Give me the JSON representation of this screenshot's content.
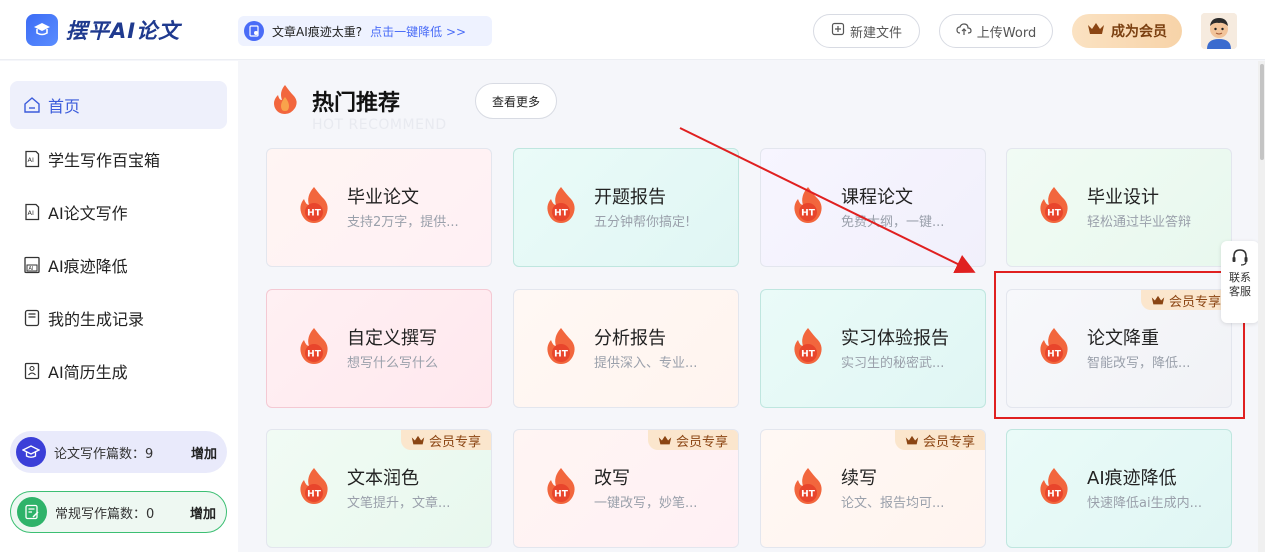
{
  "header": {
    "logo_text": "摆平AI论文",
    "notice_text": "文章AI痕迹太重?",
    "notice_link": "点击一键降低 >>",
    "new_file": "新建文件",
    "upload_word": "上传Word",
    "vip": "成为会员"
  },
  "sidebar": {
    "items": [
      {
        "label": "首页",
        "icon": "home-icon"
      },
      {
        "label": "学生写作百宝箱",
        "icon": "ai-doc-icon"
      },
      {
        "label": "AI论文写作",
        "icon": "ai-doc-icon"
      },
      {
        "label": "AI痕迹降低",
        "icon": "ai-reduce-icon"
      },
      {
        "label": "我的生成记录",
        "icon": "record-icon"
      },
      {
        "label": "AI简历生成",
        "icon": "resume-icon"
      }
    ],
    "counts": [
      {
        "label": "论文写作篇数：9",
        "action": "增加"
      },
      {
        "label": "常规写作篇数：0",
        "action": "增加"
      }
    ]
  },
  "main": {
    "section_title": "热门推荐",
    "section_subtitle": "HOT RECOMMEND",
    "more": "查看更多",
    "vip_tag": "会员专享",
    "cards": [
      {
        "name": "毕业论文",
        "desc": "支持2万字，提供..."
      },
      {
        "name": "开题报告",
        "desc": "五分钟帮你搞定!"
      },
      {
        "name": "课程论文",
        "desc": "免费大纲，一键..."
      },
      {
        "name": "毕业设计",
        "desc": "轻松通过毕业答辩"
      },
      {
        "name": "自定义撰写",
        "desc": "想写什么写什么"
      },
      {
        "name": "分析报告",
        "desc": "提供深入、专业..."
      },
      {
        "name": "实习体验报告",
        "desc": "实习生的秘密武..."
      },
      {
        "name": "论文降重",
        "desc": "智能改写，降低..."
      },
      {
        "name": "文本润色",
        "desc": "文笔提升，文章..."
      },
      {
        "name": "改写",
        "desc": "一键改写，妙笔..."
      },
      {
        "name": "续写",
        "desc": "论文、报告均可..."
      },
      {
        "name": "AI痕迹降低",
        "desc": "快速降低ai生成内..."
      }
    ],
    "fire_badge": "HT"
  },
  "customer_service": {
    "line1": "联系",
    "line2": "客服"
  },
  "colors": {
    "accent": "#3b5bdb",
    "highlight": "#e02020",
    "vip": "#8b4513"
  }
}
